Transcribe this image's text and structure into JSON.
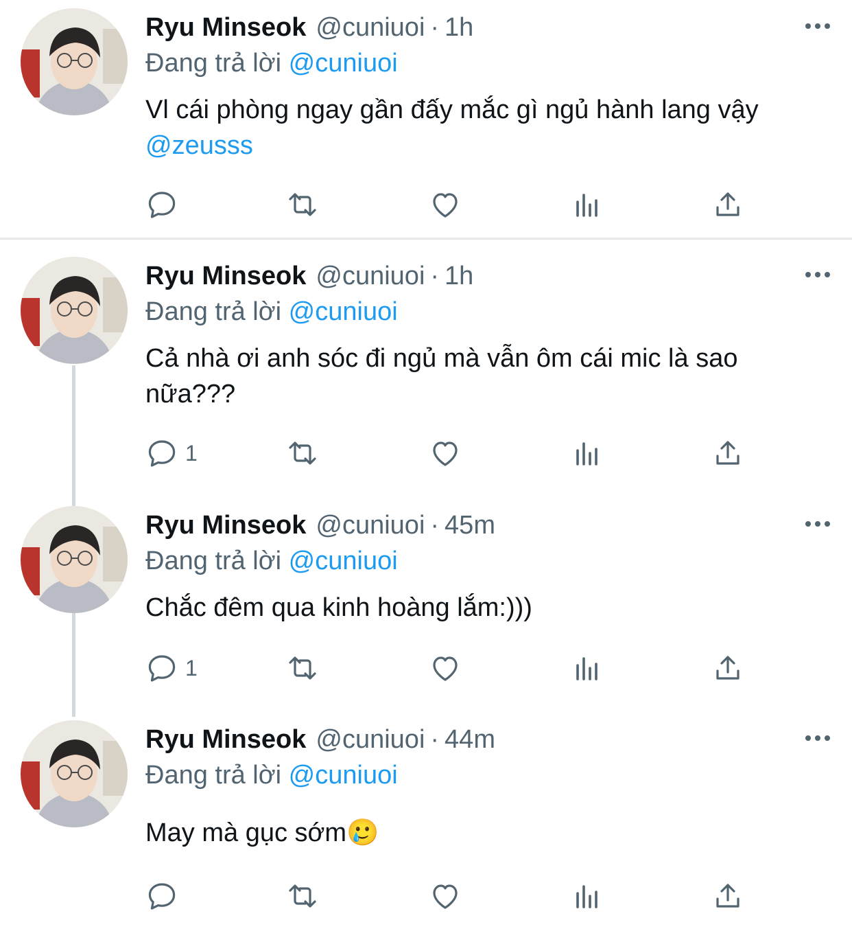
{
  "colors": {
    "text": "#0f1419",
    "secondary": "#536471",
    "accent": "#1d9bf0",
    "divider": "#e7e9ea"
  },
  "tweets": [
    {
      "name": "Ryu Minseok",
      "handle": "@cuniuoi",
      "time": "1h",
      "replying_prefix": "Đang trả lời",
      "replying_to": "@cuniuoi",
      "text": "Vl cái phòng ngay gần đấy mắc gì ngủ hành lang vậy",
      "text_mention": "@zeusss",
      "reply_count": "",
      "icons": [
        "reply-icon",
        "retweet-icon",
        "like-icon",
        "analytics-icon",
        "share-icon",
        "more-icon"
      ]
    },
    {
      "name": "Ryu Minseok",
      "handle": "@cuniuoi",
      "time": "1h",
      "replying_prefix": "Đang trả lời",
      "replying_to": "@cuniuoi",
      "text": "Cả nhà ơi anh sóc đi ngủ mà vẫn ôm cái mic là sao nữa???",
      "text_mention": "",
      "reply_count": "1"
    },
    {
      "name": "Ryu Minseok",
      "handle": "@cuniuoi",
      "time": "45m",
      "replying_prefix": "Đang trả lời",
      "replying_to": "@cuniuoi",
      "text": "Chắc đêm qua kinh hoàng lắm:)))",
      "text_mention": "",
      "reply_count": "1"
    },
    {
      "name": "Ryu Minseok",
      "handle": "@cuniuoi",
      "time": "44m",
      "replying_prefix": "Đang trả lời",
      "replying_to": "@cuniuoi",
      "text": "May mà gục sớm",
      "emoji": "🥲",
      "text_mention": "",
      "reply_count": ""
    }
  ]
}
